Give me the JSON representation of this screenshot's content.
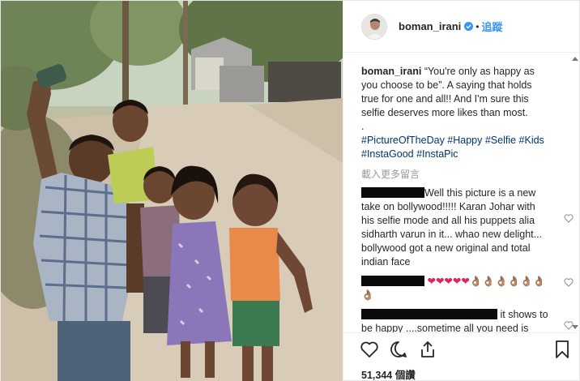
{
  "header": {
    "username": "boman_irani",
    "separator": "•",
    "follow_label": "追蹤"
  },
  "caption": {
    "username": "boman_irani",
    "text": "“You're only as happy as you choose to be”. A saying that holds true for one and all!! And I'm sure this selfie deserves more likes than most.\n.\n",
    "hashtags": "#PictureOfTheDay #Happy #Selfie #Kids #InstaGood #InstaPic"
  },
  "load_more_label": "載入更多留言",
  "comments": [
    {
      "text": "Well this picture is a new take on bollywood!!!!! Karan Johar with his selfie mode and all his puppets alia sidharth varun in it... whao new delight... bollywood got a new original and total indian face"
    },
    {
      "text": "❤❤❤❤❤👌🏽👌🏽👌🏽👌🏽👌🏽👌🏽👌🏽"
    },
    {
      "text": "it shows to be happy ....sometime all you need is innocence. "
    }
  ],
  "likes": {
    "count": "51,344",
    "unit": "個讚"
  },
  "colors": {
    "accent": "#3897f0",
    "hashtag": "#003569",
    "redaction": "#0b0b0b"
  },
  "icons": [
    "verified-badge-icon",
    "heart-icon",
    "comment-icon",
    "share-icon",
    "bookmark-icon",
    "small-heart-icon"
  ]
}
